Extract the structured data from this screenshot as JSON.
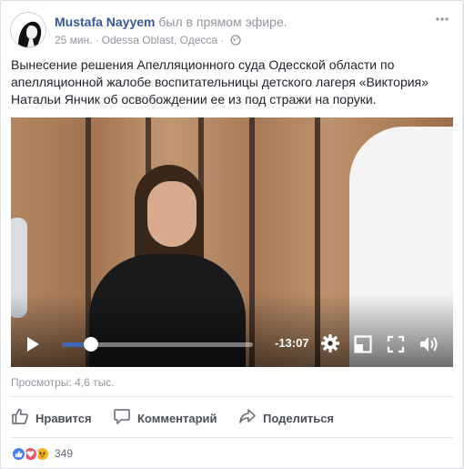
{
  "post": {
    "author": "Mustafa Nayyem",
    "action": "был в прямом эфире.",
    "time": "25 мин.",
    "separator": "·",
    "location": "Odessa Oblast, Одесса",
    "globe_separator": "·",
    "text": "Вынесение решения Апелляционного суда Одесской области по апелляционной жалобе воспитательницы детского лагеря «Виктория» Натальи Янчик об освобождении ее из под стражи на поруки."
  },
  "video": {
    "remaining_time": "-13:07",
    "progress": 0.15,
    "icons": [
      "play-icon",
      "gear-icon",
      "hd-icon",
      "fullscreen-icon",
      "volume-icon"
    ]
  },
  "stats": {
    "views": "Просмотры: 4,6 тыс.",
    "reaction_count": "349",
    "reactions": [
      "like-icon",
      "love-icon",
      "angry-icon"
    ]
  },
  "actions": {
    "like": "Нравится",
    "comment": "Комментарий",
    "share": "Поделиться"
  },
  "colors": {
    "link": "#365899",
    "meta": "#90949c",
    "accent": "#4267b2",
    "action_text": "#4b4f56"
  }
}
